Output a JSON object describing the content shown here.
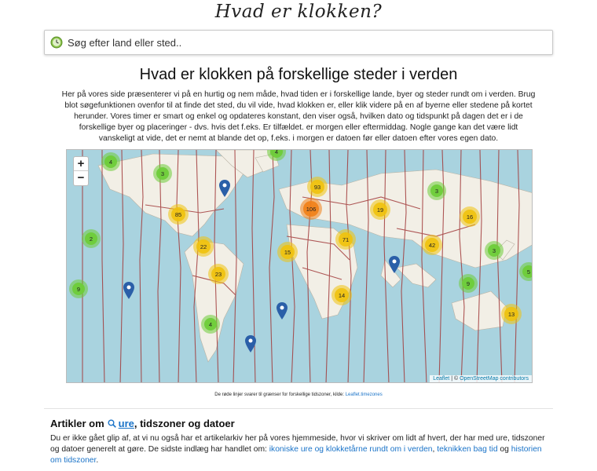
{
  "site": {
    "title": "Hvad er klokken?"
  },
  "search": {
    "placeholder": "Søg efter land eller sted.."
  },
  "heading": "Hvad er klokken på forskellige steder i verden",
  "intro": "Her på vores side præsenterer vi på en hurtig og nem måde, hvad tiden er i forskellige lande, byer og steder rundt om i verden. Brug blot søgefunktionen ovenfor til at finde det sted, du vil vide, hvad klokken er, eller klik videre på en af byerne eller stedene på kortet herunder. Vores timer er smart og enkel og opdateres konstant, den viser også, hvilken dato og tidspunkt på dagen det er i de forskellige byer og placeringer - dvs. hvis det f.eks. Er tilfældet. er morgen eller eftermiddag. Nogle gange kan det være lidt vanskeligt at vide, det er nemt at blande det op, f.eks. i morgen er datoen før eller datoen efter vores egen dato.",
  "map": {
    "zoom_in": "+",
    "zoom_out": "−",
    "attribution_leaflet": "Leaflet",
    "attribution_sep": " | © ",
    "attribution_osm": "OpenStreetMap contributors",
    "clusters": [
      {
        "count": "4",
        "color": "green"
      },
      {
        "count": "3",
        "color": "green"
      },
      {
        "count": "4",
        "color": "green"
      },
      {
        "count": "93",
        "color": "yellow"
      },
      {
        "count": "3",
        "color": "green"
      },
      {
        "count": "85",
        "color": "yellow"
      },
      {
        "count": "106",
        "color": "orange"
      },
      {
        "count": "19",
        "color": "yellow"
      },
      {
        "count": "16",
        "color": "yellow"
      },
      {
        "count": "2",
        "color": "green"
      },
      {
        "count": "22",
        "color": "yellow"
      },
      {
        "count": "15",
        "color": "yellow"
      },
      {
        "count": "71",
        "color": "yellow"
      },
      {
        "count": "42",
        "color": "yellow"
      },
      {
        "count": "3",
        "color": "green"
      },
      {
        "count": "5",
        "color": "green"
      },
      {
        "count": "23",
        "color": "yellow"
      },
      {
        "count": "9",
        "color": "green"
      },
      {
        "count": "9",
        "color": "green"
      },
      {
        "count": "14",
        "color": "yellow"
      },
      {
        "count": "4",
        "color": "green"
      },
      {
        "count": "13",
        "color": "yellow"
      }
    ],
    "pin_color": "#2a5fa8"
  },
  "caption": {
    "text": "De røde linjer svarer til grænser for forskellige tidszoner, kilde: ",
    "link": "Leaflet.timezones"
  },
  "articles": {
    "title_prefix": "Artikler om",
    "title_link": "ure",
    "title_suffix": ", tidszoner og datoer",
    "text": "Du er ikke gået glip af, at vi nu også har et artikelarkiv her på vores hjemmeside, hvor vi skriver om lidt af hvert, der har med ure, tidszoner og datoer generelt at gøre. De sidste indlæg har handlet om: ",
    "link1": "ikoniske ure og klokketårne rundt om i verden",
    "sep1": ", ",
    "link2": "teknikken bag tid",
    "sep2": " og ",
    "link3": "historien om tidszoner",
    "end": "."
  }
}
